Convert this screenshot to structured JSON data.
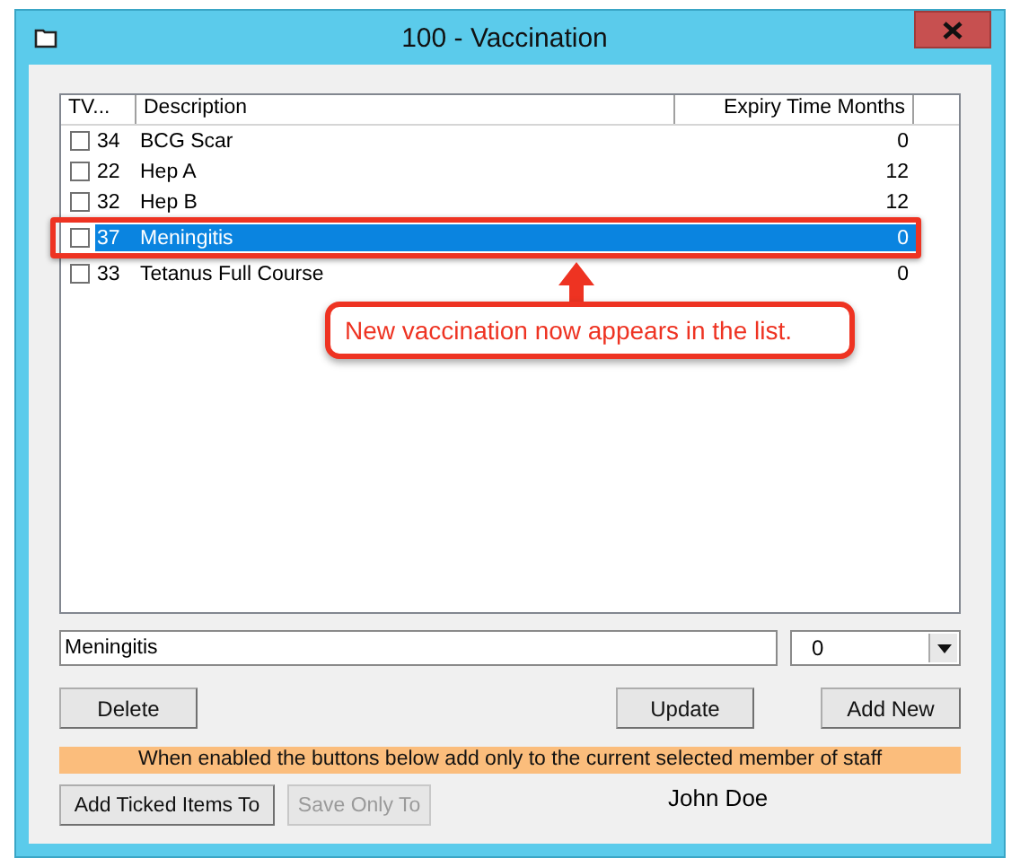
{
  "window": {
    "title": "100 - Vaccination"
  },
  "table": {
    "columns": [
      "TV...",
      "Description",
      "Expiry Time Months"
    ],
    "rows": [
      {
        "code": "34",
        "description": "BCG Scar",
        "expiry": "0",
        "checked": false,
        "selected": false
      },
      {
        "code": "22",
        "description": "Hep A",
        "expiry": "12",
        "checked": false,
        "selected": false
      },
      {
        "code": "32",
        "description": "Hep B",
        "expiry": "12",
        "checked": false,
        "selected": false
      },
      {
        "code": "37",
        "description": "Meningitis",
        "expiry": "0",
        "checked": false,
        "selected": true
      },
      {
        "code": "33",
        "description": "Tetanus Full Course",
        "expiry": "0",
        "checked": false,
        "selected": false
      }
    ]
  },
  "annotation": {
    "text": "New vaccination now appears in the list."
  },
  "description_field": {
    "value": "Meningitis"
  },
  "expiry_dropdown": {
    "value": "0"
  },
  "buttons": [
    {
      "label": "Delete",
      "disabled": false
    },
    {
      "label": "Update",
      "disabled": false
    },
    {
      "label": "Add New",
      "disabled": false
    }
  ],
  "notice": "When enabled the buttons below add only to the current selected member of staff",
  "staff_buttons": [
    {
      "label": "Add Ticked Items To",
      "disabled": false
    },
    {
      "label": "Save Only To",
      "disabled": true
    }
  ],
  "staff_name": "John Doe"
}
